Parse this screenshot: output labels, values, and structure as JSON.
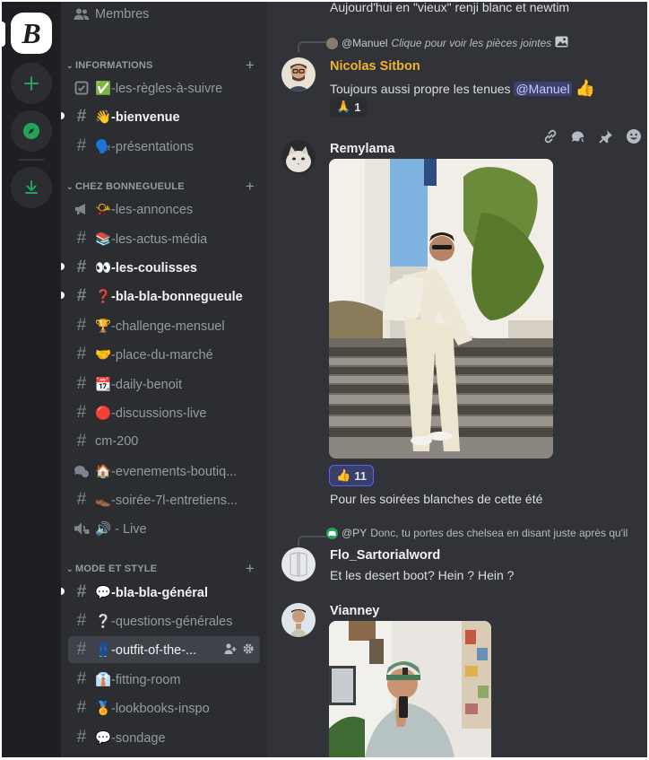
{
  "rail": {
    "logo_letter": "B"
  },
  "sidebar": {
    "top_item": {
      "label": "Membres"
    },
    "categories": {
      "informations": "INFORMATIONS",
      "chez": "CHEZ BONNEGUEULE",
      "mode": "MODE ET STYLE"
    },
    "channels": {
      "regles": "✅-les-règles-à-suivre",
      "bienvenue": "👋-bienvenue",
      "presentations": "🗣️-présentations",
      "annonces": "📯-les-annonces",
      "actus": "📚-les-actus-média",
      "coulisses": "👀-les-coulisses",
      "blabla_bg": "❓-bla-bla-bonnegueule",
      "challenge": "🏆-challenge-mensuel",
      "marche": "🤝-place-du-marché",
      "daily": "📆-daily-benoit",
      "discussions": "🔴-discussions-live",
      "cm200": "cm-200",
      "evenements": "🏠-evenements-boutiq...",
      "soiree": "👞-soirée-7l-entretiens...",
      "live": "🔊 - Live",
      "blabla_gen": "💬-bla-bla-général",
      "questions": "❔-questions-générales",
      "outfit": "👖-outfit-of-the-...",
      "fitting": "👔-fitting-room",
      "lookbooks": "🏅-lookbooks-inspo",
      "sondage": "💬-sondage"
    }
  },
  "chat": {
    "top_fragment": "Aujourd'hui en \"vieux\" renji blanc et newtim",
    "msg1": {
      "reply_user": "@Manuel",
      "reply_text": "Clique pour voir les pièces jointes",
      "author": "Nicolas Sitbon",
      "author_color": "#f0b232",
      "text_before": "Toujours aussi propre les tenues ",
      "mention": "@Manuel",
      "emoji": "👍",
      "reaction_emoji": "🙏",
      "reaction_count": "1"
    },
    "msg2": {
      "author": "Remylama",
      "reaction_emoji": "👍",
      "reaction_count": "11",
      "text": "Pour les soirées blanches de cette été"
    },
    "msg3": {
      "reply_user": "@PY",
      "reply_text": "Donc, tu portes des chelsea en disant juste après qu'il",
      "author": "Flo_Sartorialword",
      "text": "Et les desert boot? Hein ? Hein ?"
    },
    "msg4": {
      "author": "Vianney"
    }
  },
  "colors": {
    "accent": "#5865f2",
    "green": "#23a559",
    "background": "#313338",
    "sidebar": "#2b2d31"
  }
}
